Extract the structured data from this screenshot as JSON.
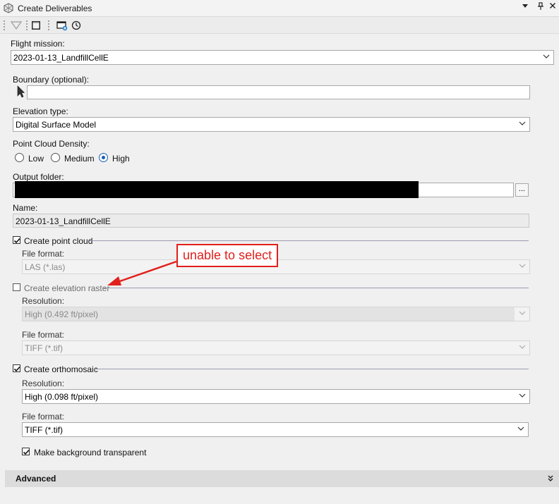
{
  "window": {
    "title": "Create Deliverables",
    "menu_icon": "chevron-down-icon",
    "pin_icon": "pin-icon",
    "close_icon": "close-icon"
  },
  "toolbar": {
    "icons": [
      "filter-icon",
      "console-icon",
      "add-window-icon",
      "history-clock-icon"
    ]
  },
  "flight_mission": {
    "label": "Flight mission:",
    "value": "2023-01-13_LandfillCellE"
  },
  "boundary": {
    "label": "Boundary (optional):",
    "value": ""
  },
  "elevation_type": {
    "label": "Elevation type:",
    "value": "Digital Surface Model"
  },
  "point_cloud_density": {
    "label": "Point Cloud Density:",
    "options": [
      "Low",
      "Medium",
      "High"
    ],
    "selected": "High"
  },
  "output_folder": {
    "label": "Output folder:",
    "browse_label": "..."
  },
  "name": {
    "label": "Name:",
    "value": "2023-01-13_LandfillCellE"
  },
  "create_point_cloud": {
    "label": "Create point cloud",
    "checked": true,
    "file_format_label": "File format:",
    "file_format_value": "LAS (*.las)"
  },
  "create_elevation_raster": {
    "label": "Create elevation raster",
    "checked": false,
    "resolution_label": "Resolution:",
    "resolution_value": "High (0.492 ft/pixel)",
    "file_format_label": "File format:",
    "file_format_value": "TIFF (*.tif)"
  },
  "create_orthomosaic": {
    "label": "Create orthomosaic",
    "checked": true,
    "resolution_label": "Resolution:",
    "resolution_value": "High (0.098 ft/pixel)",
    "file_format_label": "File format:",
    "file_format_value": "TIFF (*.tif)",
    "transparent_label": "Make background transparent",
    "transparent_checked": true
  },
  "annotation": {
    "text": "unable to select",
    "color": "#e2201c"
  },
  "advanced": {
    "label": "Advanced",
    "expand_icon": "double-chevron-down-icon"
  },
  "colors": {
    "accent": "#1a5fb4",
    "annotation": "#e2201c"
  }
}
